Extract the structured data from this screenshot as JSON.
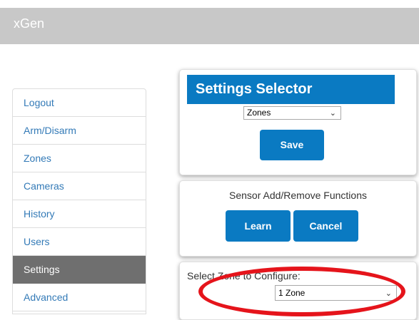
{
  "header": {
    "brand": "xGen"
  },
  "sidebar": {
    "items": [
      {
        "label": "Logout"
      },
      {
        "label": "Arm/Disarm"
      },
      {
        "label": "Zones"
      },
      {
        "label": "Cameras"
      },
      {
        "label": "History"
      },
      {
        "label": "Users"
      },
      {
        "label": "Settings",
        "active": true
      },
      {
        "label": "Advanced"
      }
    ]
  },
  "settings_selector": {
    "title": "Settings Selector",
    "selected": "Zones",
    "save_label": "Save"
  },
  "sensor_functions": {
    "title": "Sensor Add/Remove Functions",
    "learn_label": "Learn",
    "cancel_label": "Cancel"
  },
  "zone_config": {
    "label": "Select Zone to Configure:",
    "selected": "1 Zone"
  },
  "colors": {
    "header_bg": "#c8c8c8",
    "accent": "#0a7ac2",
    "active_nav": "#6f6f6f",
    "link": "#337ab7",
    "highlight_ring": "#e5141b"
  }
}
